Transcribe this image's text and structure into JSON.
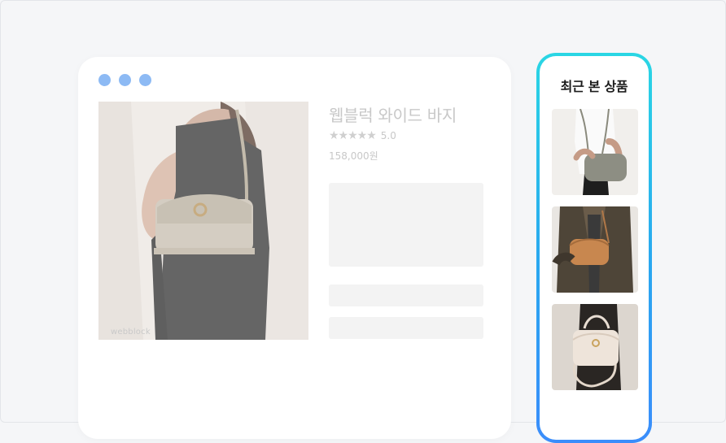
{
  "browser": {
    "dot_color": "#8dbaf4",
    "product": {
      "image_icon": "handbag-photo",
      "watermark": "webblock",
      "title": "웹블럭 와이드 바지",
      "stars": "★★★★★",
      "rating": "5.0",
      "price": "158,000원"
    }
  },
  "recent": {
    "title": "최근 본 상품",
    "items": [
      {
        "icon": "gray-crossbody-bag-photo"
      },
      {
        "icon": "tan-crossbody-bag-photo"
      },
      {
        "icon": "cream-top-handle-bag-photo"
      }
    ]
  }
}
